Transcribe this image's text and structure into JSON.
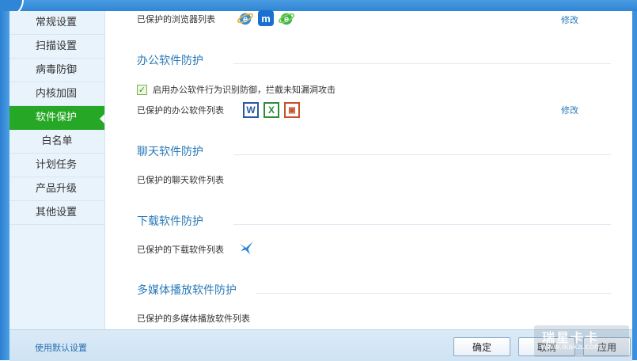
{
  "sidebar": {
    "items": [
      {
        "label": "常规设置"
      },
      {
        "label": "扫描设置"
      },
      {
        "label": "病毒防御"
      },
      {
        "label": "内核加固"
      },
      {
        "label": "软件保护"
      },
      {
        "label": "白名单"
      },
      {
        "label": "计划任务"
      },
      {
        "label": "产品升级"
      },
      {
        "label": "其他设置"
      }
    ]
  },
  "browser": {
    "list_label": "已保护的浏览器列表",
    "modify": "修改",
    "icons": [
      "ie-icon",
      "maxthon-icon",
      "ie-green-icon"
    ]
  },
  "office": {
    "title": "办公软件防护",
    "checkbox_label": "启用办公软件行为识别防御，拦截未知漏洞攻击",
    "list_label": "已保护的办公软件列表",
    "modify": "修改",
    "icons": [
      "word-icon",
      "excel-icon",
      "powerpoint-icon"
    ]
  },
  "chat": {
    "title": "聊天软件防护",
    "list_label": "已保护的聊天软件列表"
  },
  "download": {
    "title": "下载软件防护",
    "list_label": "已保护的下载软件列表",
    "icons": [
      "thunder-bird-icon"
    ]
  },
  "media": {
    "title": "多媒体播放软件防护",
    "list_label": "已保护的多媒体播放软件列表"
  },
  "footer": {
    "default_link": "使用默认设置",
    "ok": "确定",
    "cancel": "取消",
    "apply": "应用"
  },
  "watermark": {
    "brand": "瑞星卡卡",
    "url": "www.ikaka.com"
  },
  "colors": {
    "accent": "#2a7ab8",
    "active_nav": "#26a826",
    "sidebar_bg": "#e9f3fb"
  }
}
